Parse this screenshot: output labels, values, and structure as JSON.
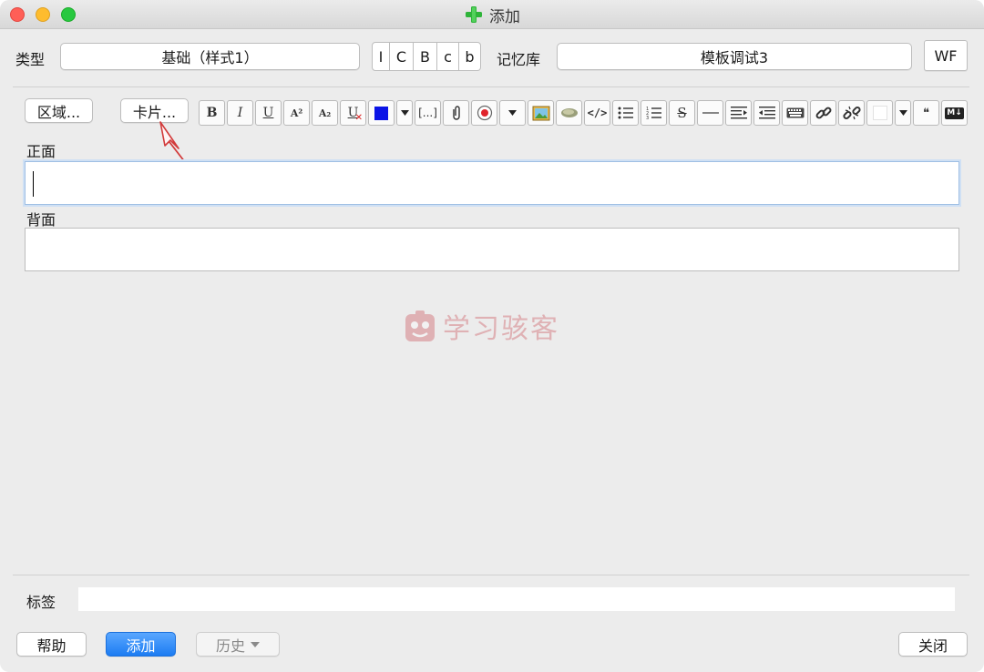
{
  "window": {
    "title": "添加"
  },
  "row1": {
    "type_label": "类型",
    "type_value": "基础（样式1）",
    "segments": [
      "I",
      "C",
      "B",
      "c",
      "b"
    ],
    "deck_label": "记忆库",
    "deck_value": "模板调试3",
    "wf_label": "WF"
  },
  "row2": {
    "fields_button": "区域...",
    "cards_button": "卡片..."
  },
  "toolbar": {
    "items": [
      {
        "name": "bold-icon",
        "glyph": "B"
      },
      {
        "name": "italic-icon",
        "glyph": "I"
      },
      {
        "name": "underline-icon",
        "glyph": "U"
      },
      {
        "name": "superscript-icon",
        "glyph": "A²"
      },
      {
        "name": "subscript-icon",
        "glyph": "A₂"
      },
      {
        "name": "clear-format-icon",
        "glyph": "U"
      },
      {
        "name": "text-color-icon",
        "glyph": ""
      },
      {
        "name": "text-color-dropdown-icon",
        "glyph": ""
      },
      {
        "name": "cloze-icon",
        "glyph": "[...]"
      },
      {
        "name": "attach-icon",
        "glyph": ""
      },
      {
        "name": "record-icon",
        "glyph": ""
      },
      {
        "name": "record-dropdown-icon",
        "glyph": ""
      },
      {
        "name": "image-icon",
        "glyph": ""
      },
      {
        "name": "eraser-icon",
        "glyph": ""
      },
      {
        "name": "code-icon",
        "glyph": "</>"
      },
      {
        "name": "bullet-list-icon",
        "glyph": ""
      },
      {
        "name": "numbered-list-icon",
        "glyph": ""
      },
      {
        "name": "strikethrough-icon",
        "glyph": "S"
      },
      {
        "name": "horizontal-rule-icon",
        "glyph": ""
      },
      {
        "name": "indent-icon",
        "glyph": ""
      },
      {
        "name": "outdent-icon",
        "glyph": ""
      },
      {
        "name": "keyboard-icon",
        "glyph": ""
      },
      {
        "name": "link-icon",
        "glyph": ""
      },
      {
        "name": "unlink-icon",
        "glyph": ""
      },
      {
        "name": "background-color-icon",
        "glyph": ""
      },
      {
        "name": "background-color-dropdown-icon",
        "glyph": ""
      },
      {
        "name": "quote-icon",
        "glyph": "❝"
      },
      {
        "name": "markdown-icon",
        "glyph": "M↓"
      }
    ]
  },
  "colors": {
    "text_color": "#0a14e6",
    "record_color": "#e0242c",
    "arrow_color": "#d23a3a",
    "primary_button": "#1c7cf2"
  },
  "fields": {
    "front_label": "正面",
    "back_label": "背面"
  },
  "watermark": {
    "text": "学习骇客"
  },
  "tags": {
    "label": "标签"
  },
  "bottom": {
    "help_button": "帮助",
    "add_button": "添加",
    "history_button": "历史",
    "close_button": "关闭"
  }
}
